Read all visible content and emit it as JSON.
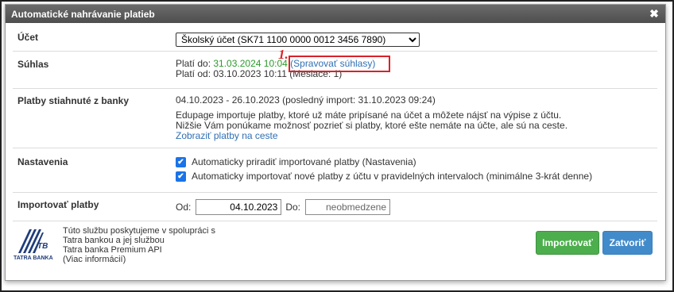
{
  "dialog": {
    "title": "Automatické nahrávanie platieb"
  },
  "account": {
    "label": "Účet",
    "selected": "Školský účet (SK71 1100 0000 0012 3456 7890)"
  },
  "consent": {
    "label": "Súhlas",
    "valid_to_prefix": "Platí do:",
    "valid_to_value": "31.03.2024 10:04",
    "manage_link": "(Spravovať súhlasy)",
    "valid_from_line": "Platí od: 03.10.2023 10:11 (Mesiace: 1)",
    "annotation_number": "1."
  },
  "downloaded": {
    "label": "Platby stiahnuté z banky",
    "range_line": "04.10.2023 - 26.10.2023 (posledný import: 31.10.2023 09:24)",
    "info_line1": "Edupage importuje platby, ktoré už máte pripísané na účet a môžete nájsť na výpise z účtu.",
    "info_line2": "Nižšie Vám ponúkame možnosť pozrieť si platby, ktoré ešte nemáte na účte, ale sú na ceste.",
    "show_link": "Zobraziť platby na ceste"
  },
  "settings": {
    "label": "Nastavenia",
    "option1": "Automaticky priradiť importované platby (Nastavenia)",
    "option1_checked": true,
    "option2": "Automaticky importovať nové platby z účtu v pravidelných intervaloch (minimálne 3-krát denne)",
    "option2_checked": true
  },
  "import_payments": {
    "label": "Importovať platby",
    "from_label": "Od:",
    "from_value": "04.10.2023",
    "to_label": "Do:",
    "to_placeholder": "neobmedzene"
  },
  "footer": {
    "logo_text": "TATRA BANKA",
    "logo_mark": "TB",
    "info_line1": "Túto službu poskytujeme v spolupráci s",
    "info_line2": "Tatra bankou a jej službou",
    "info_line3": "Tatra banka Premium API",
    "info_line4": "(Viac informácií)",
    "import_button": "Importovať",
    "close_button": "Zatvoriť"
  },
  "colors": {
    "title_bar": "#555555",
    "green_date": "#2a9a2a",
    "link": "#2f6fb4",
    "annotation": "#d9222a",
    "import_btn": "#4cae4c",
    "close_btn": "#428bca",
    "checkbox": "#1a73e8"
  }
}
